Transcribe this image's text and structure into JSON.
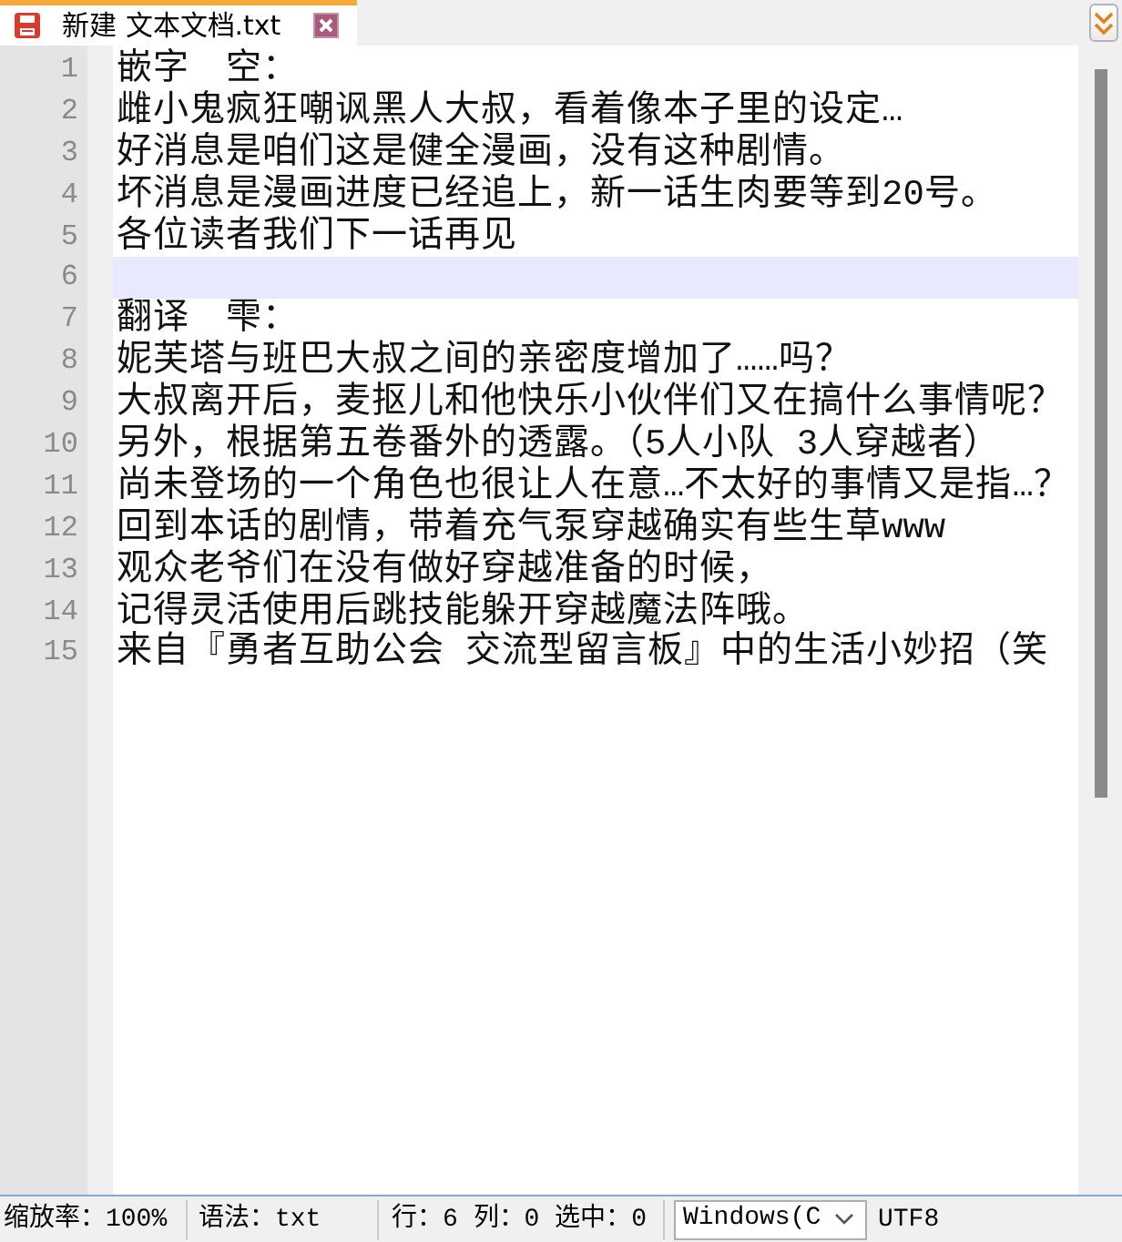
{
  "tabs": [
    {
      "label": "新建 文本文档.txt",
      "selected": true
    }
  ],
  "editor": {
    "lines": [
      {
        "number": "1",
        "text": "嵌字　空：",
        "current": false
      },
      {
        "number": "2",
        "text": "雌小鬼疯狂嘲讽黑人大叔，看着像本子里的设定…",
        "current": false
      },
      {
        "number": "3",
        "text": "好消息是咱们这是健全漫画，没有这种剧情。",
        "current": false
      },
      {
        "number": "4",
        "text": "坏消息是漫画进度已经追上，新一话生肉要等到20号。",
        "current": false
      },
      {
        "number": "5",
        "text": "各位读者我们下一话再见",
        "current": false
      },
      {
        "number": "6",
        "current": true
      },
      {
        "number": "7",
        "text": "翻译　雫：",
        "current": false
      },
      {
        "number": "8",
        "text": "妮芙塔与班巴大叔之间的亲密度增加了……吗？",
        "current": false
      },
      {
        "number": "9",
        "text": "大叔离开后，麦抠儿和他快乐小伙伴们又在搞什么事情呢？",
        "current": false
      },
      {
        "number": "10",
        "text": "另外，根据第五卷番外的透露。（5人小队 3人穿越者）",
        "current": false
      },
      {
        "number": "11",
        "text": "尚未登场的一个角色也很让人在意…不太好的事情又是指…？",
        "current": false
      },
      {
        "number": "12",
        "text": "回到本话的剧情，带着充气泵穿越确实有些生草www",
        "current": false
      },
      {
        "number": "13",
        "text": "观众老爷们在没有做好穿越准备的时候，",
        "current": false
      },
      {
        "number": "14",
        "text": "记得灵活使用后跳技能躲开穿越魔法阵哦。",
        "current": false
      },
      {
        "number": "15",
        "text": "来自『勇者互助公会 交流型留言板』中的生活小妙招（笑",
        "current": false
      }
    ]
  },
  "status_bar": {
    "zoom": "缩放率：100%",
    "syntax": "语法：txt",
    "position": "行：6 列：0 选中：0",
    "line_ending": "Windows(C",
    "encoding": "UTF8"
  }
}
